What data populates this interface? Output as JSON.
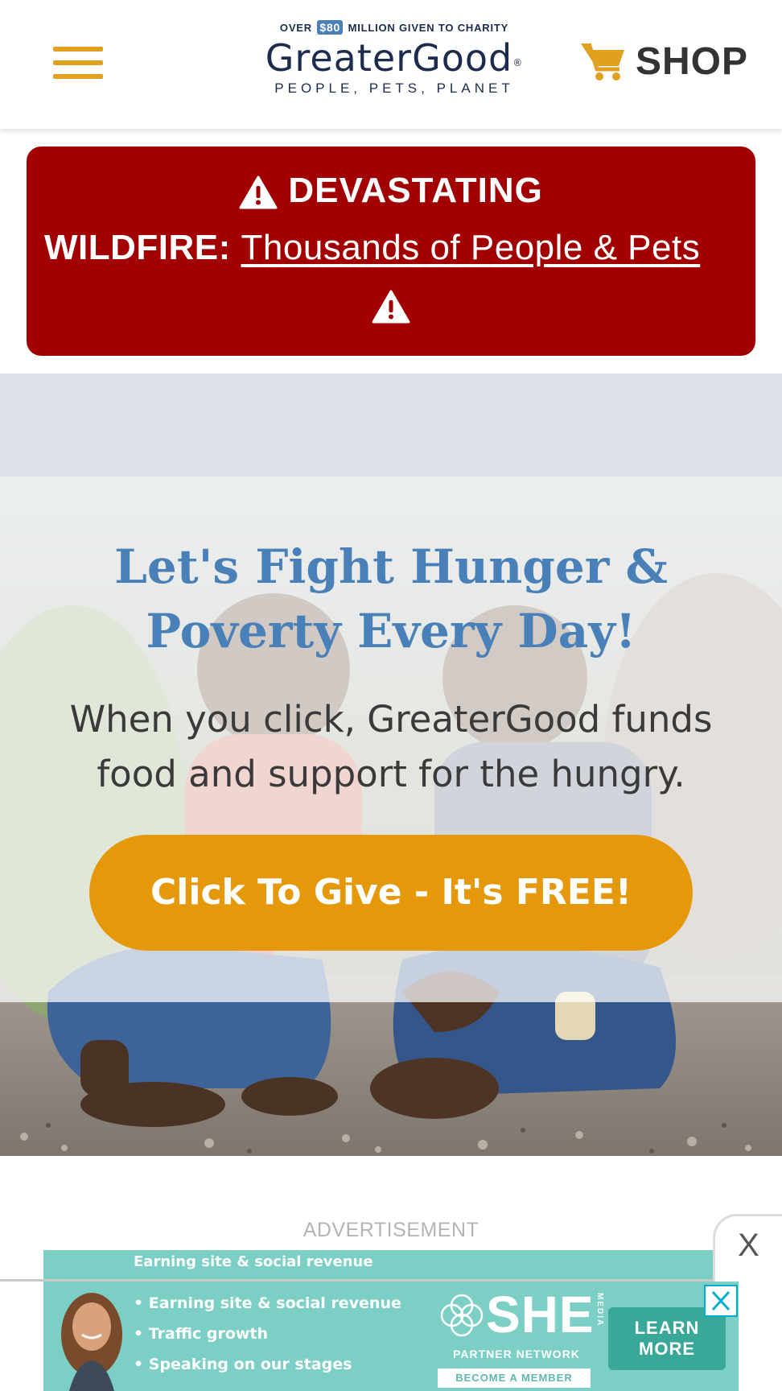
{
  "header": {
    "menu_icon": "hamburger-menu-icon",
    "logo": {
      "tagline_before": "OVER",
      "tagline_amount": "$80",
      "tagline_after": "MILLION GIVEN TO CHARITY",
      "name": "GreaterGood",
      "registered": "®",
      "subtitle": "PEOPLE, PETS, PLANET"
    },
    "shop": {
      "icon": "shopping-cart-icon",
      "label": "SHOP"
    }
  },
  "alert": {
    "icon": "warning-triangle-icon",
    "line1": "DEVASTATING",
    "line2_prefix": "WILDFIRE:",
    "link_text": "Thousands of People & Pets"
  },
  "hero": {
    "title": "Let's Fight Hunger & Poverty Every Day!",
    "body": "When you click, GreaterGood funds food and support for the hungry.",
    "cta_label": "Click To Give - It's FREE!"
  },
  "ad": {
    "label": "ADVERTISEMENT",
    "close_label": "X",
    "bullets": [
      "Earning site & social revenue",
      "Traffic growth",
      "Speaking on our stages"
    ],
    "brand": "SHE",
    "brand_vertical": "MEDIA",
    "partner": "PARTNER NETWORK",
    "member": "BECOME A MEMBER",
    "learn_more": "LEARN MORE"
  },
  "colors": {
    "accent": "#e5980a",
    "alert_red": "#a20000",
    "title_blue": "#4a80b8",
    "navy": "#1c2b4e",
    "ad_teal": "#7bcfc4"
  }
}
